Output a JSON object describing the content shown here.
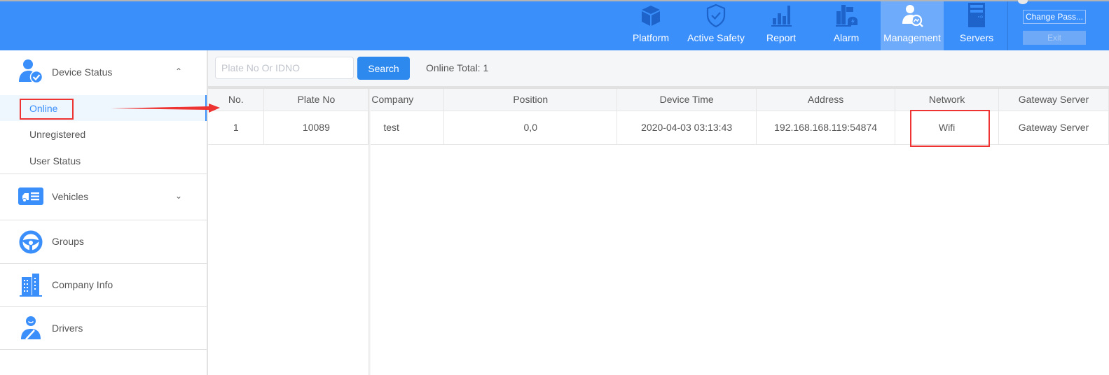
{
  "header": {
    "nav": [
      {
        "label": "Platform",
        "icon": "cube-icon",
        "active": false
      },
      {
        "label": "Active Safety",
        "icon": "shield-check-icon",
        "active": false
      },
      {
        "label": "Report",
        "icon": "bar-chart-icon",
        "active": false
      },
      {
        "label": "Alarm",
        "icon": "alarm-siren-icon",
        "active": false
      },
      {
        "label": "Management",
        "icon": "user-search-icon",
        "active": true
      },
      {
        "label": "Servers",
        "icon": "server-icon",
        "active": false
      }
    ],
    "change_password_label": "Change Pass...",
    "exit_label": "Exit"
  },
  "sidebar": {
    "groups": [
      {
        "label": "Device Status",
        "icon": "user-check-icon",
        "expanded": true,
        "chevron": "chevron-up-icon",
        "items": [
          {
            "label": "Online",
            "active": true
          },
          {
            "label": "Unregistered",
            "active": false
          },
          {
            "label": "User Status",
            "active": false
          }
        ]
      },
      {
        "label": "Vehicles",
        "icon": "vehicle-list-icon",
        "expanded": false,
        "chevron": "chevron-down-icon"
      },
      {
        "label": "Groups",
        "icon": "steering-wheel-icon"
      },
      {
        "label": "Company Info",
        "icon": "building-icon"
      },
      {
        "label": "Drivers",
        "icon": "driver-seatbelt-icon"
      }
    ]
  },
  "toolbar": {
    "search_placeholder": "Plate No Or IDNO",
    "search_value": "",
    "search_label": "Search",
    "online_total": "Online Total: 1"
  },
  "table": {
    "columns": [
      "No.",
      "Plate No",
      "Company",
      "Position",
      "Device Time",
      "Address",
      "Network",
      "Gateway Server"
    ],
    "rows": [
      [
        "1",
        "10089",
        "test",
        "0,0",
        "2020-04-03 03:13:43",
        "192.168.168.119:54874",
        "Wifi",
        "Gateway Server"
      ]
    ]
  },
  "colors": {
    "header_bg": "#3a8ffb",
    "active_nav_bg": "#6eabfb",
    "accent": "#3a8ffb",
    "search_button": "#2d89ee",
    "annotation": "#ee3333"
  }
}
